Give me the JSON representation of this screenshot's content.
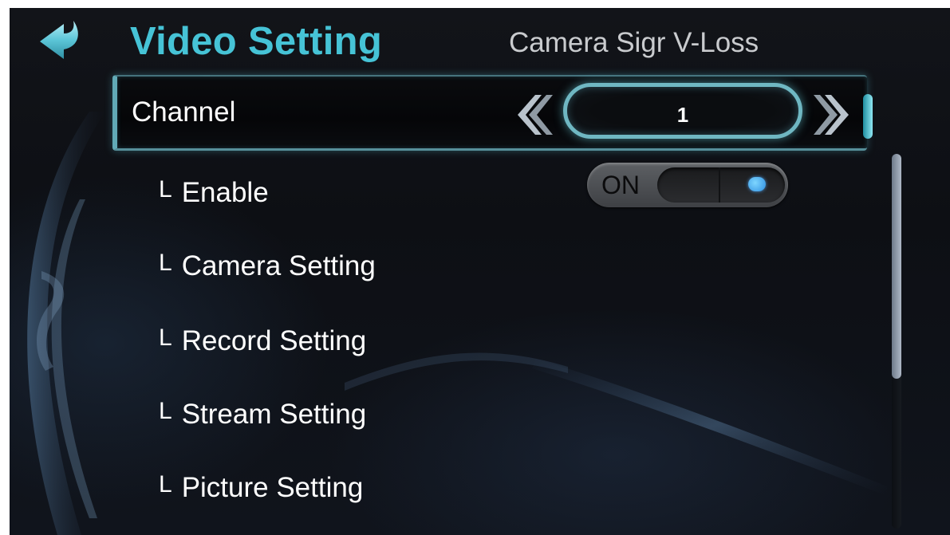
{
  "header": {
    "title": "Video Setting",
    "tab_label": "Camera Sigr V-Loss"
  },
  "channel": {
    "label": "Channel",
    "value": "1"
  },
  "sub_items": [
    {
      "prefix": "L",
      "label": "Enable",
      "toggle_state": "ON"
    },
    {
      "prefix": "L",
      "label": "Camera Setting"
    },
    {
      "prefix": "L",
      "label": "Record Setting"
    },
    {
      "prefix": "L",
      "label": "Stream Setting"
    },
    {
      "prefix": "L",
      "label": "Picture Setting"
    }
  ],
  "scrollbar": {
    "visible_fraction": 0.6
  },
  "icons": {
    "back": "back-arrow-icon",
    "prev": "chevron-left-icon",
    "next": "chevron-right-icon"
  },
  "colors": {
    "accent": "#46c3d6",
    "background": "#0d0f14",
    "text": "#ffffff",
    "toggle_knob": "#2f8fe0"
  }
}
